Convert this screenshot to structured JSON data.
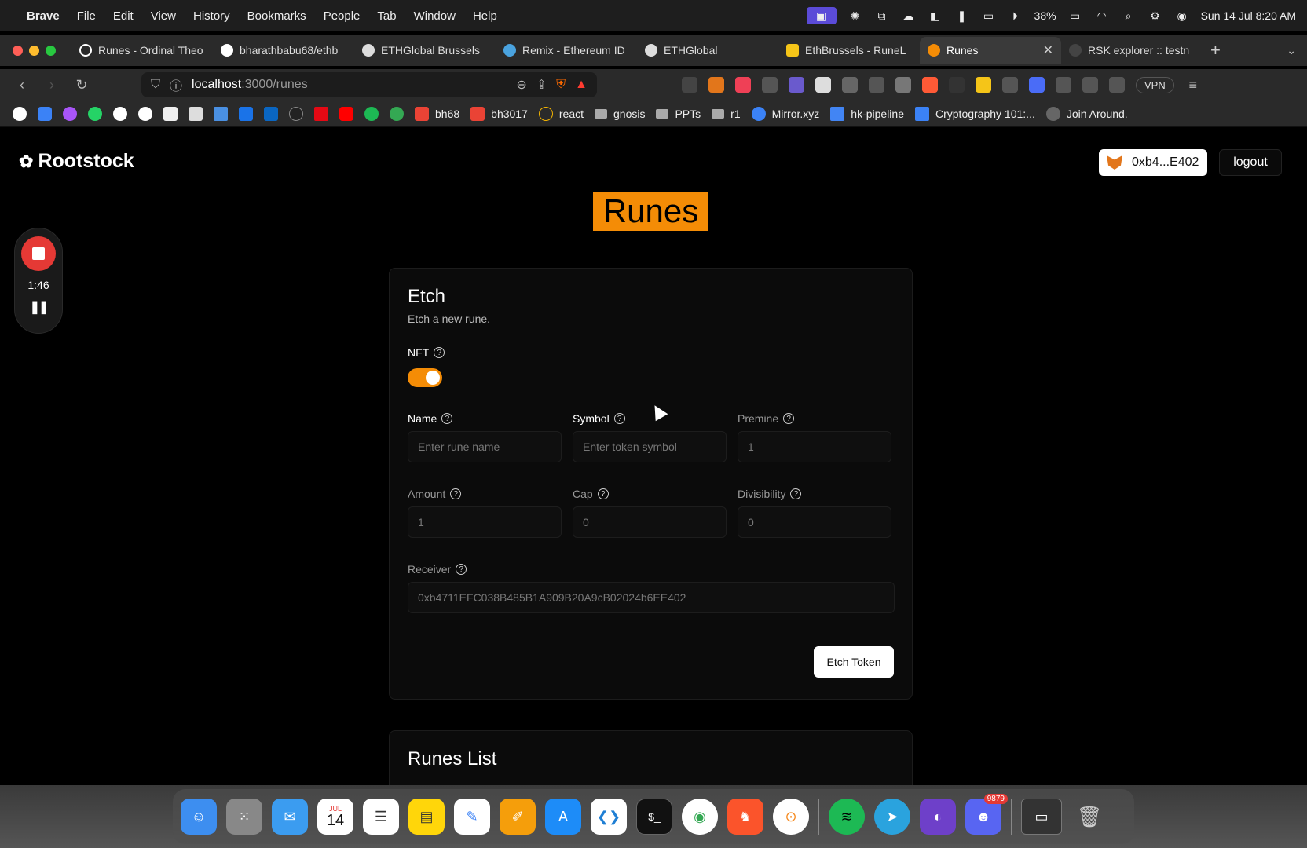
{
  "menubar": {
    "app": "Brave",
    "items": [
      "File",
      "Edit",
      "View",
      "History",
      "Bookmarks",
      "People",
      "Tab",
      "Window",
      "Help"
    ],
    "battery": "38%",
    "datetime": "Sun 14 Jul  8:20 AM"
  },
  "tabs": [
    {
      "label": "Runes - Ordinal Theo",
      "color": "#ffffff"
    },
    {
      "label": "bharathbabu68/ethb",
      "color": "#ffffff"
    },
    {
      "label": "ETHGlobal Brussels",
      "color": "#dddddd"
    },
    {
      "label": "Remix - Ethereum ID",
      "color": "#4aa3df"
    },
    {
      "label": "ETHGlobal",
      "color": "#dddddd"
    },
    {
      "label": "EthBrussels - RuneL",
      "color": "#f5c518"
    },
    {
      "label": "Runes",
      "color": "#f48c06"
    },
    {
      "label": "RSK explorer :: testn",
      "color": "#333333"
    }
  ],
  "url": {
    "host": "localhost",
    "path": ":3000/runes"
  },
  "vpn": "VPN",
  "bookmarks": [
    {
      "label": "bh68",
      "icon": "gmail-icon"
    },
    {
      "label": "bh3017",
      "icon": "gmail-icon"
    },
    {
      "label": "react",
      "icon": "react-icon"
    },
    {
      "label": "gnosis",
      "icon": "folder-icon"
    },
    {
      "label": "PPTs",
      "icon": "folder-icon"
    },
    {
      "label": "r1",
      "icon": "folder-icon"
    },
    {
      "label": "Mirror.xyz",
      "icon": "mirror-icon"
    },
    {
      "label": "hk-pipeline",
      "icon": "doc-icon"
    },
    {
      "label": "Cryptography 101:...",
      "icon": "zotero-icon"
    },
    {
      "label": "Join Around.",
      "icon": "around-icon"
    }
  ],
  "page": {
    "brand": "Rootstock",
    "wallet": "0xb4...E402",
    "logout": "logout",
    "title": "Runes",
    "accent": "#f48c06"
  },
  "recorder": {
    "time": "1:46"
  },
  "etch": {
    "title": "Etch",
    "description": "Etch a new rune.",
    "nft_label": "NFT",
    "nft_enabled": true,
    "name": {
      "label": "Name",
      "placeholder": "Enter rune name"
    },
    "symbol": {
      "label": "Symbol",
      "placeholder": "Enter token symbol"
    },
    "premine": {
      "label": "Premine",
      "value": "1"
    },
    "amount": {
      "label": "Amount",
      "value": "1"
    },
    "cap": {
      "label": "Cap",
      "value": "0"
    },
    "divisibility": {
      "label": "Divisibility",
      "value": "0"
    },
    "receiver": {
      "label": "Receiver",
      "value": "0xb4711EFC038B485B1A909B20A9cB02024b6EE402"
    },
    "submit": "Etch Token"
  },
  "runes_list": {
    "title": "Runes List"
  },
  "dock": {
    "calendar_month": "JUL",
    "calendar_day": "14",
    "discord_badge": "9879"
  }
}
